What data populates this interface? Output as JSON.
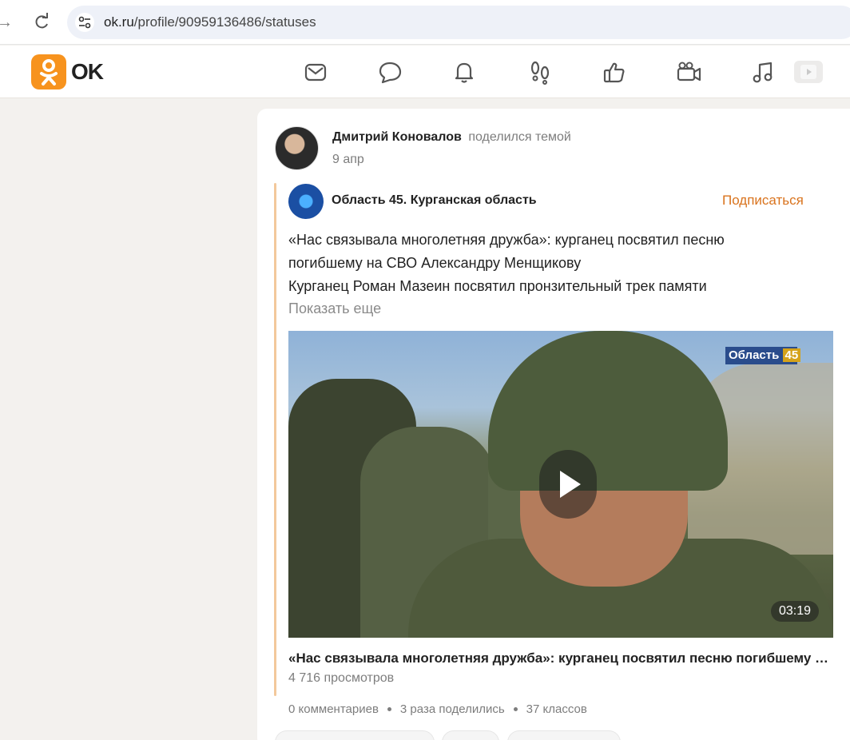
{
  "browser": {
    "url_host": "ok.ru",
    "url_path": "/profile/90959136486/statuses"
  },
  "header": {
    "logo_text": "OK",
    "nav_icons": [
      "messages-icon",
      "discussions-icon",
      "notifications-icon",
      "guests-icon",
      "likes-icon",
      "video-icon",
      "music-icon",
      "more-icon"
    ]
  },
  "post": {
    "author_name": "Дмитрий Коновалов",
    "author_action": "поделился темой",
    "date": "9 апр",
    "group": {
      "name": "Область 45. Курганская область",
      "subscribe_label": "Подписаться"
    },
    "text_lines": [
      "«Нас связывала многолетняя дружба»: курганец посвятил песню",
      "погибшему на СВО Александру Менщикову",
      "Курганец Роман Мазеин посвятил пронзительный трек памяти"
    ],
    "show_more_label": "Показать еще",
    "video": {
      "channel_badge_text": "Область",
      "channel_badge_number": "45",
      "duration": "03:19",
      "title": "«Нас связывала многолетняя дружба»: курганец посвятил песню погибшему на СВО Александру Менщикову",
      "views": "4 716 просмотров"
    },
    "stats": {
      "comments": "0 комментариев",
      "shares": "3 раза поделились",
      "likes": "37 классов"
    }
  }
}
